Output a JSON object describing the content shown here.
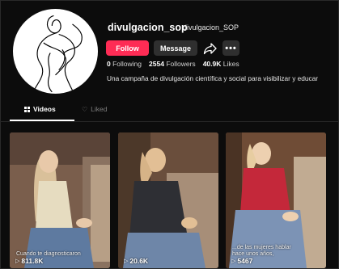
{
  "profile": {
    "username": "divulgacion_sop",
    "nickname": "divulgacion_SOP",
    "follow_label": "Follow",
    "message_label": "Message",
    "more_label": "•••",
    "share_icon": "share-icon",
    "stats": {
      "following_value": "0",
      "following_label": "Following",
      "followers_value": "2554",
      "followers_label": "Followers",
      "likes_value": "40.9K",
      "likes_label": "Likes"
    },
    "bio": "Una campaña de divulgación científica y social para visibilizar y educar"
  },
  "tabs": [
    {
      "label": "Videos",
      "icon": "grid-icon",
      "active": true
    },
    {
      "label": "Liked",
      "icon": "heart-icon",
      "active": false
    }
  ],
  "videos": [
    {
      "caption": "Cuando te diagnosticaron",
      "views": "811.8K"
    },
    {
      "caption": "",
      "views": "20.6K"
    },
    {
      "caption": "...de las mujeres hablar\nhace unos años,",
      "views": "5467"
    }
  ],
  "colors": {
    "accent": "#fe2c55",
    "background": "#0c0c0c",
    "button_dark": "#2f2f2f"
  }
}
